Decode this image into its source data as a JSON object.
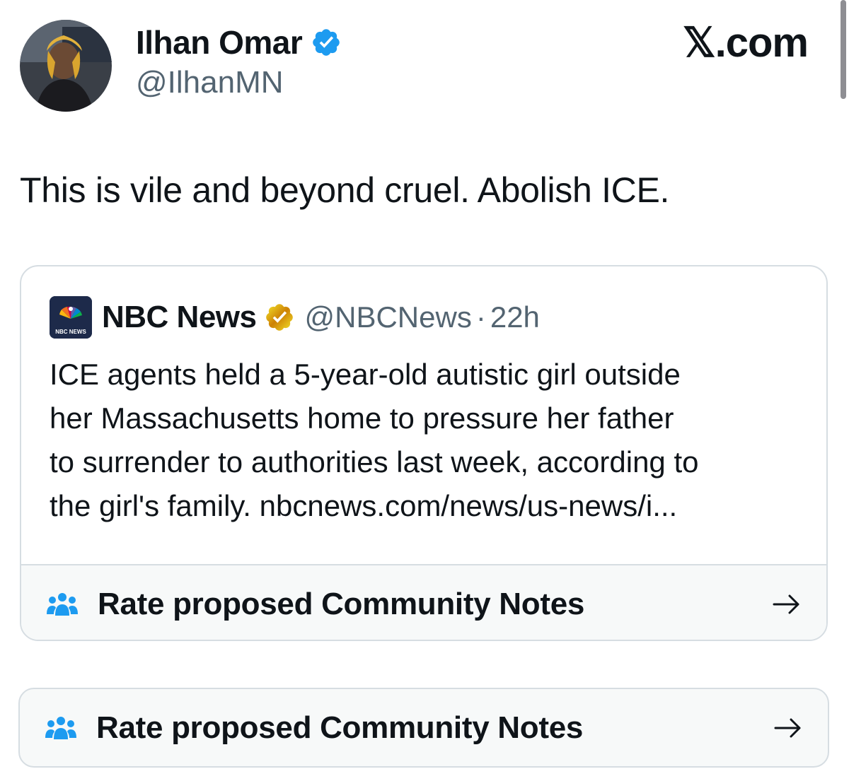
{
  "header": {
    "author_name": "Ilhan Omar",
    "author_handle": "@IlhanMN",
    "verified_icon": "verified-badge-blue",
    "site_label": "𝕏.com"
  },
  "tweet": {
    "text": "This is vile and beyond cruel. Abolish ICE."
  },
  "quoted_tweet": {
    "source_name": "NBC News",
    "logo_text": "NBC NEWS",
    "badge_icon": "verified-badge-gold",
    "handle": "@NBCNews",
    "separator": "·",
    "time": "22h",
    "body_lines": [
      "ICE agents held a 5-year-old autistic girl outside",
      "her Massachusetts home to pressure her father",
      "to surrender to authorities last week, according to",
      "the girl's family. nbcnews.com/news/us-news/i..."
    ],
    "community_notes": {
      "label": "Rate proposed Community Notes",
      "icon": "people-icon",
      "arrow": "→"
    }
  },
  "community_notes_standalone": {
    "label": "Rate proposed Community Notes",
    "icon": "people-icon",
    "arrow": "→"
  },
  "colors": {
    "text_primary": "#0f1419",
    "text_secondary": "#536471",
    "verified_blue": "#1d9bf0",
    "verified_gold": "#e2b719",
    "notes_icon_blue": "#1d9bf0",
    "border": "#d6dde2",
    "notes_background": "#f7f9f9"
  }
}
